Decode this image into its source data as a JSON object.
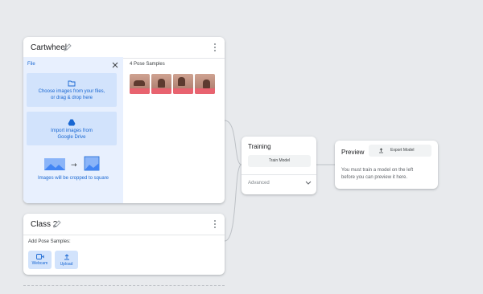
{
  "class1": {
    "title": "Cartwheel"
  },
  "upload_panel": {
    "heading": "File",
    "choose_line1": "Choose images from your files,",
    "choose_line2": "or drag & drop here",
    "import_line1": "Import images from",
    "import_line2": "Google Drive",
    "crop_note": "Images will be cropped to square"
  },
  "samples": {
    "label": "4 Pose Samples",
    "count": 4
  },
  "class2": {
    "title": "Class 2",
    "add_label": "Add Pose Samples:",
    "webcam_label": "Webcam",
    "upload_label": "Upload"
  },
  "training": {
    "title": "Training",
    "train_button": "Train Model",
    "advanced": "Advanced"
  },
  "preview": {
    "title": "Preview",
    "export_button": "Export Model",
    "message_line1": "You must train a model on the left",
    "message_line2": "before you can preview it here."
  },
  "colors": {
    "accent": "#1967d2",
    "panel": "#e8f0fe",
    "tile": "#d2e3fc",
    "sample_stripe": "#e8636f"
  }
}
